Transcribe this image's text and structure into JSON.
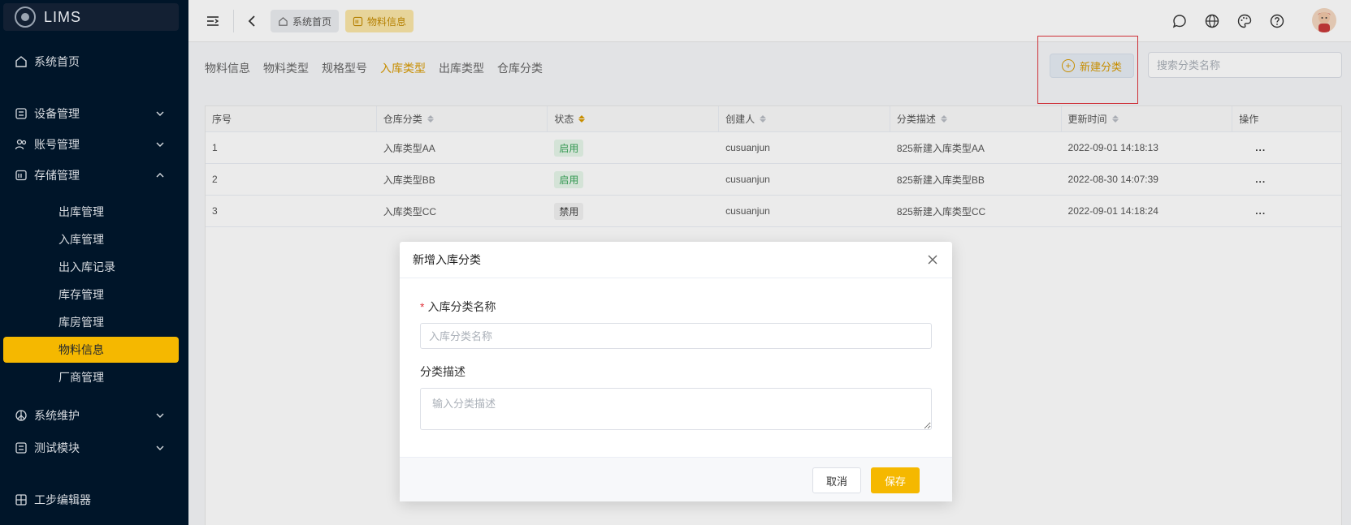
{
  "app": {
    "logo_text": "LIMS"
  },
  "sidebar": {
    "items": [
      {
        "label": "系统首页",
        "icon": "home-icon"
      },
      {
        "label": "设备管理",
        "icon": "device-icon"
      },
      {
        "label": "账号管理",
        "icon": "users-icon"
      },
      {
        "label": "存储管理",
        "icon": "storage-icon"
      },
      {
        "label": "系统维护",
        "icon": "maintenance-icon"
      },
      {
        "label": "测试模块",
        "icon": "test-module-icon"
      },
      {
        "label": "工步编辑器",
        "icon": "editor-icon"
      }
    ],
    "storage_children": [
      "出库管理",
      "入库管理",
      "出入库记录",
      "库存管理",
      "库房管理",
      "物料信息",
      "厂商管理"
    ],
    "active_child": "物料信息"
  },
  "header": {
    "breadcrumb_home": "系统首页",
    "breadcrumb_active": "物料信息"
  },
  "subtabs": [
    "物料信息",
    "物料类型",
    "规格型号",
    "入库类型",
    "出库类型",
    "仓库分类"
  ],
  "active_subtab": "入库类型",
  "toolbar": {
    "new_button_label": "新建分类",
    "search_placeholder": "搜索分类名称"
  },
  "table": {
    "columns": [
      "序号",
      "仓库分类",
      "状态",
      "创建人",
      "分类描述",
      "更新时间",
      "操作"
    ],
    "rows": [
      {
        "no": "1",
        "category": "入库类型AA",
        "status": "启用",
        "creator": "cusuanjun",
        "desc": "825新建入库类型AA",
        "updated": "2022-09-01 14:18:13",
        "action": "..."
      },
      {
        "no": "2",
        "category": "入库类型BB",
        "status": "启用",
        "creator": "cusuanjun",
        "desc": "825新建入库类型BB",
        "updated": "2022-08-30 14:07:39",
        "action": "..."
      },
      {
        "no": "3",
        "category": "入库类型CC",
        "status": "禁用",
        "creator": "cusuanjun",
        "desc": "825新建入库类型CC",
        "updated": "2022-09-01 14:18:24",
        "action": "..."
      }
    ]
  },
  "modal": {
    "title": "新增入库分类",
    "required_mark": "*",
    "name_label": "入库分类名称",
    "name_placeholder": "入库分类名称",
    "desc_label": "分类描述",
    "desc_placeholder": "输入分类描述",
    "cancel_label": "取消",
    "save_label": "保存"
  },
  "colors": {
    "accent": "#f5b800",
    "sidebar_bg": "#001529",
    "enabled": "#3aa55a",
    "highlight_border": "#e0353c"
  }
}
